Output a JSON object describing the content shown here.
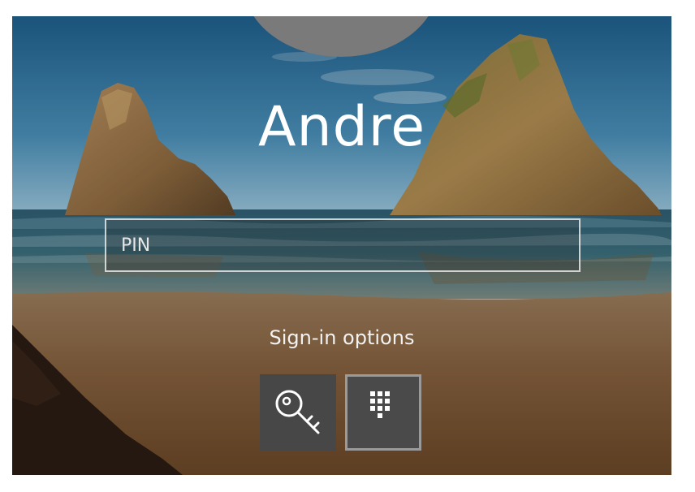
{
  "lock_screen": {
    "user_name": "Andre",
    "pin_field": {
      "placeholder": "PIN",
      "value": ""
    },
    "signin_options_label": "Sign-in options",
    "options": [
      {
        "icon": "key-icon",
        "selected": false
      },
      {
        "icon": "pin-keypad-icon",
        "selected": true
      }
    ]
  },
  "colors": {
    "text": "#ffffff",
    "option_button_bg": "#474747",
    "selected_border": "#9a9a9a",
    "avatar": "#7a7a7a"
  }
}
